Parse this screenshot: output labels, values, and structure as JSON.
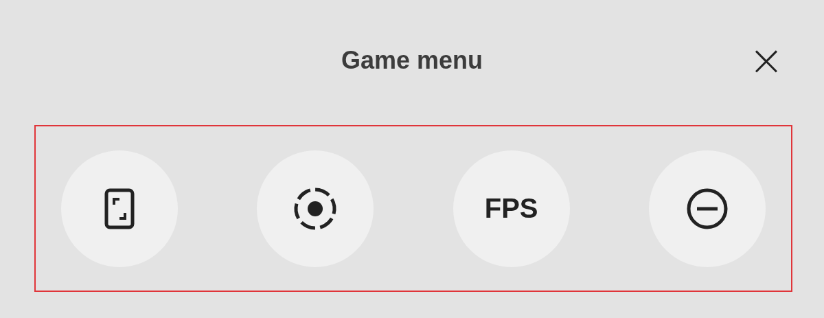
{
  "title": "Game menu",
  "close": "×",
  "tiles_highlighted": true,
  "tiles": [
    {
      "kind": "phone"
    },
    {
      "kind": "record"
    },
    {
      "kind": "text",
      "label": "FPS"
    },
    {
      "kind": "minus"
    }
  ]
}
